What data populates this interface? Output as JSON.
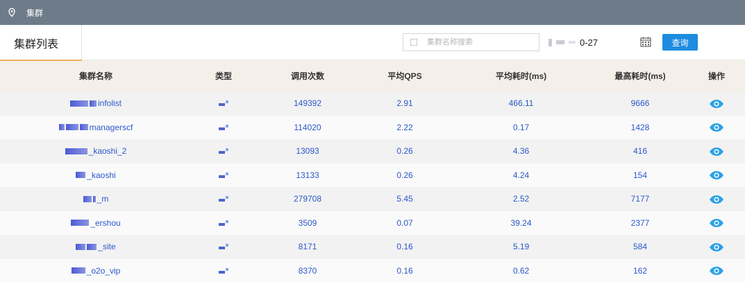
{
  "topbar": {
    "title": "集群"
  },
  "panel": {
    "title": "集群列表",
    "search": {
      "placeholder": "集群名称搜索",
      "value": ""
    },
    "date": {
      "value": "0-27"
    },
    "query_button": "查询"
  },
  "table": {
    "columns": [
      "集群名称",
      "类型",
      "调用次数",
      "平均QPS",
      "平均耗时(ms)",
      "最高耗时(ms)",
      "操作"
    ],
    "rows": [
      {
        "name": "infolist",
        "calls": "149392",
        "qps": "2.91",
        "avg": "466.11",
        "max": "9666"
      },
      {
        "name": "managerscf",
        "calls": "114020",
        "qps": "2.22",
        "avg": "0.17",
        "max": "1428"
      },
      {
        "name": "_kaoshi_2",
        "calls": "13093",
        "qps": "0.26",
        "avg": "4.36",
        "max": "416"
      },
      {
        "name": "_kaoshi",
        "calls": "13133",
        "qps": "0.26",
        "avg": "4.24",
        "max": "154"
      },
      {
        "name": "_m",
        "calls": "279708",
        "qps": "5.45",
        "avg": "2.52",
        "max": "7177"
      },
      {
        "name": "_ershou",
        "calls": "3509",
        "qps": "0.07",
        "avg": "39.24",
        "max": "2377"
      },
      {
        "name": "_site",
        "calls": "8171",
        "qps": "0.16",
        "avg": "5.19",
        "max": "584"
      },
      {
        "name": "_o2o_vip",
        "calls": "8370",
        "qps": "0.16",
        "avg": "0.62",
        "max": "162"
      }
    ]
  },
  "icons": {
    "header": "location-pin-icon",
    "type": "type-icon",
    "action": "eye-icon",
    "date": "calendar-icon"
  },
  "colors": {
    "topbar": "#6e7b89",
    "accent": "#1d8ce0",
    "link": "#2a57c9",
    "header_row": "#f5efe9",
    "tab_underline": "#f0b15a"
  }
}
